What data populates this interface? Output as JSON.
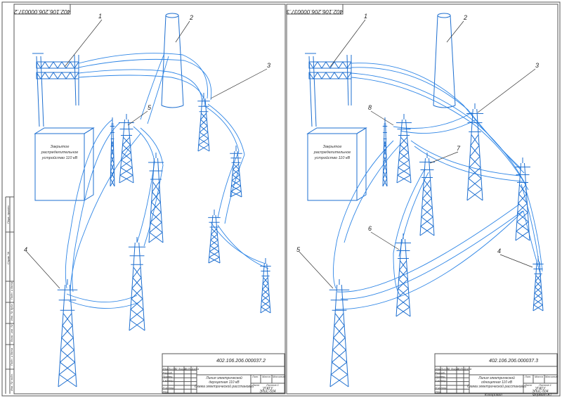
{
  "sheets": [
    {
      "id": "left",
      "corner_code": "402.106.206.000037.2",
      "title_block": {
        "code": "402.106.206.000037.2",
        "title_line1": "Линия электрической",
        "title_line2": "двухцепная 110 кВ",
        "title_line3": "Схема электрической расстановки",
        "org_line1": "УГАТУ",
        "org_line2": "ЭЛиС-504",
        "col_headers": [
          "Изм.",
          "Лист",
          "№ докум.",
          "Подп.",
          "Дата"
        ],
        "role_rows": [
          "Разраб.",
          "Провер.",
          "Т.контр.",
          "",
          "Н.контр.",
          "Утв."
        ],
        "lit_label": "Лит.",
        "mass_label": "Масса",
        "scale_label": "Масштаб",
        "sheet_label": "Лист",
        "sheets_label": "Листов 1"
      },
      "substation_label": [
        "Закрытое",
        "распределительное",
        "устройство 110 кВ"
      ],
      "callouts": [
        "1",
        "2",
        "3",
        "4",
        "5"
      ]
    },
    {
      "id": "right",
      "corner_code": "402.106.206.000037.3",
      "title_block": {
        "code": "402.106.206.000037.3",
        "title_line1": "Линия электрической",
        "title_line2": "одноцепная 110 кВ",
        "title_line3": "Схема электрической расстановки",
        "org_line1": "УГАТУ",
        "org_line2": "ЭЛиС-504",
        "col_headers": [
          "Изм.",
          "Лист",
          "№ докум.",
          "Подп.",
          "Дата"
        ],
        "role_rows": [
          "Разраб.",
          "Провер.",
          "Т.контр.",
          "",
          "Н.контр.",
          "Утв."
        ],
        "lit_label": "Лит.",
        "mass_label": "Масса",
        "scale_label": "Масштаб",
        "sheet_label": "Лист",
        "sheets_label": "Листов 1"
      },
      "substation_label": [
        "Закрытое",
        "распределительное",
        "устройство 110 кВ"
      ],
      "callouts": [
        "1",
        "2",
        "3",
        "4",
        "5",
        "6",
        "7",
        "8"
      ]
    }
  ],
  "left_margin_stamps": [
    "Перв. примен.",
    "Справ. №",
    "Подп. и дата",
    "Инв. № дубл.",
    "Взам. инв. №",
    "Подп. и дата",
    "Инв. № подл."
  ],
  "footer": {
    "copied": "Копировал",
    "format": "Формат   А1"
  },
  "colors": {
    "ink": "#1e6fd0",
    "frame": "#555555",
    "paper": "#ffffff"
  }
}
